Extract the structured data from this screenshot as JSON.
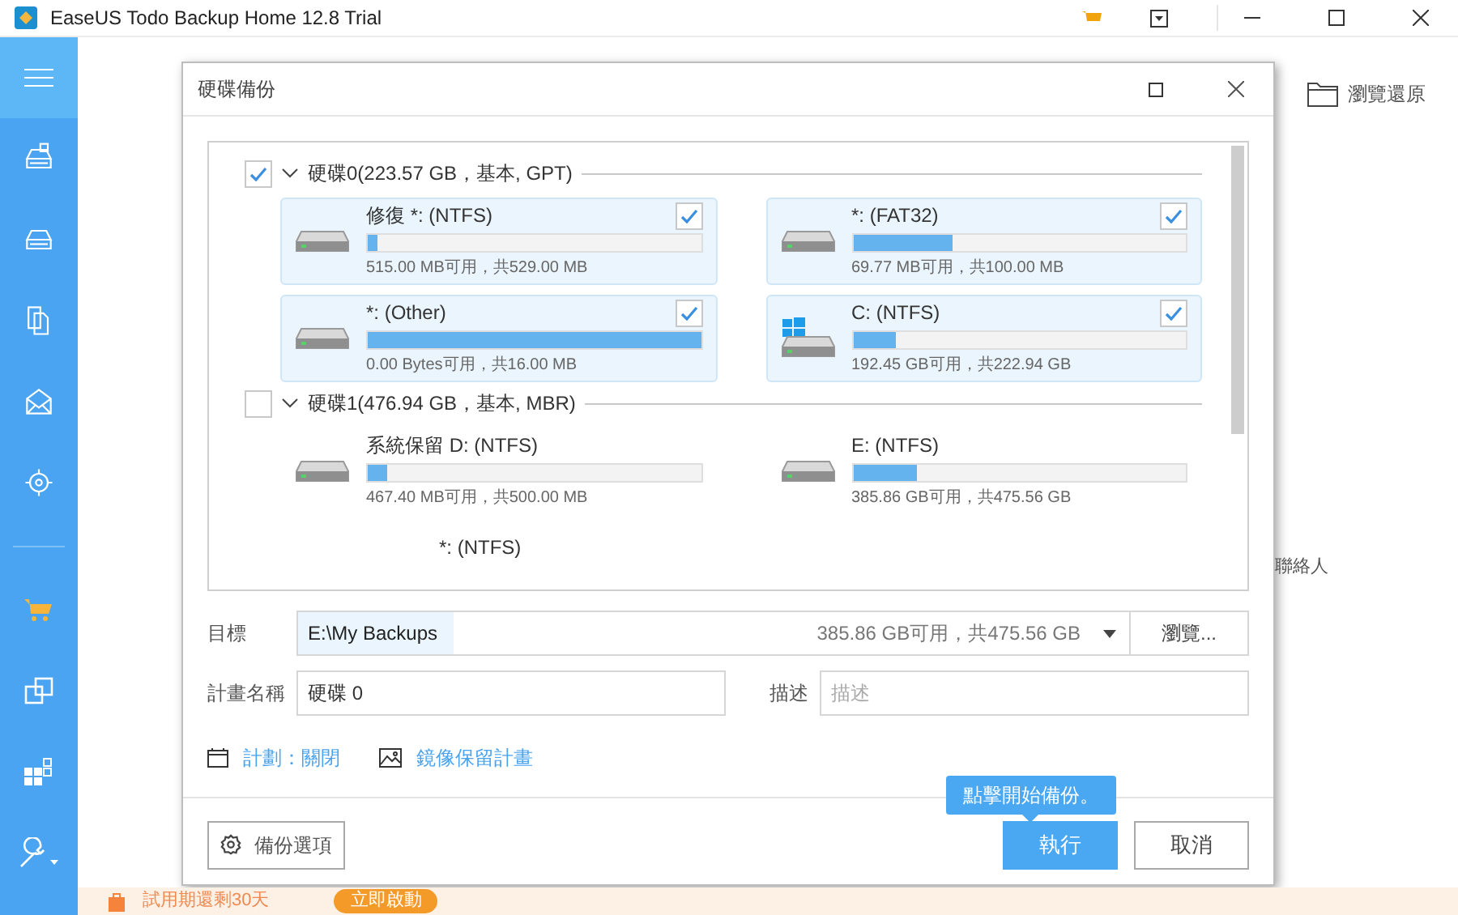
{
  "window": {
    "title": "EaseUS Todo Backup Home 12.8 Trial"
  },
  "background": {
    "browse_restore": "瀏覽還原",
    "contacts": "聯絡人",
    "trial": "試用期還剩30天",
    "activate": "立即啟動"
  },
  "dialog": {
    "title": "硬碟備份",
    "disks": [
      {
        "label": "硬碟0(223.57 GB，基本, GPT)",
        "checked": true,
        "expanded": true,
        "partitions": [
          {
            "name": "修復 *: (NTFS)",
            "info": "515.00 MB可用，共529.00 MB",
            "level": 0.03,
            "checked": true,
            "kind": "drive"
          },
          {
            "name": "*: (FAT32)",
            "info": "69.77 MB可用，共100.00 MB",
            "level": 0.3,
            "checked": true,
            "kind": "drive"
          },
          {
            "name": "*: (Other)",
            "info": "0.00 Bytes可用，共16.00 MB",
            "level": 1,
            "checked": true,
            "kind": "drive"
          },
          {
            "name": "C: (NTFS)",
            "info": "192.45 GB可用，共222.94 GB",
            "level": 0.13,
            "checked": true,
            "kind": "system"
          }
        ]
      },
      {
        "label": "硬碟1(476.94 GB，基本, MBR)",
        "checked": false,
        "expanded": true,
        "partitions": [
          {
            "name": "系統保留 D: (NTFS)",
            "info": "467.40 MB可用，共500.00 MB",
            "level": 0.06,
            "checked": false,
            "kind": "drive"
          },
          {
            "name": "E: (NTFS)",
            "info": "385.86 GB可用，共475.56 GB",
            "level": 0.19,
            "checked": false,
            "kind": "drive"
          },
          {
            "name": "*: (NTFS)",
            "kind": "cut"
          }
        ]
      }
    ],
    "target": {
      "label": "目標",
      "value": "E:\\My Backups",
      "info": "385.86 GB可用，共475.56 GB",
      "browse": "瀏覽..."
    },
    "plan_name": {
      "label": "計畫名稱",
      "value": "硬碟 0"
    },
    "description": {
      "label": "描述",
      "placeholder": "描述"
    },
    "schedule": "計劃：關閉",
    "retention": "鏡像保留計畫",
    "options": "備份選項",
    "tooltip": "點擊開始備份。",
    "run": "執行",
    "cancel": "取消"
  }
}
